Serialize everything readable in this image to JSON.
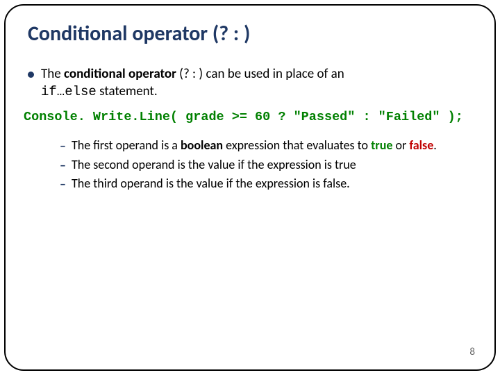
{
  "title": "Conditional operator (? : )",
  "bullet": {
    "pre": "The ",
    "bold": "conditional operator",
    "paren": " (? : ) can be used in place of an ",
    "mono": "if…else",
    "post": " statement."
  },
  "code": "Console. Write.Line( grade >= 60 ? \"Passed\" : \"Failed\" );",
  "sub": {
    "i1a": "The first operand is a ",
    "i1b": "boolean",
    "i1c": " expression that evaluates to ",
    "i1true": "true",
    "i1d": " or ",
    "i1false": "false",
    "i1e": ".",
    "i2": "The second operand is the value if the expression is true",
    "i3": "The third operand is the value if the expression is false."
  },
  "page": "8"
}
